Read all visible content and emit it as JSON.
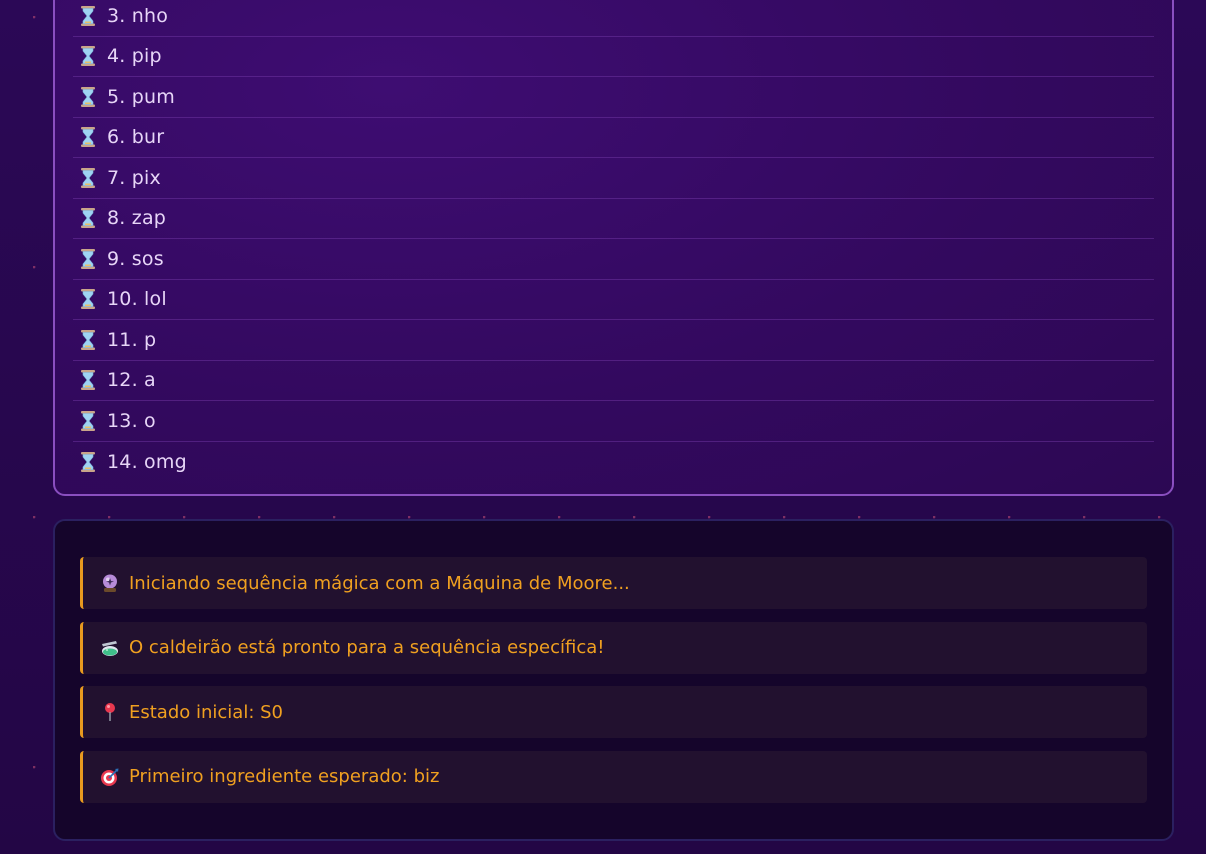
{
  "sequence": {
    "items": [
      {
        "label": "3. nho",
        "icon": "hourglass-icon"
      },
      {
        "label": "4. pip",
        "icon": "hourglass-icon"
      },
      {
        "label": "5. pum",
        "icon": "hourglass-icon"
      },
      {
        "label": "6. bur",
        "icon": "hourglass-icon"
      },
      {
        "label": "7. pix",
        "icon": "hourglass-icon"
      },
      {
        "label": "8. zap",
        "icon": "hourglass-icon"
      },
      {
        "label": "9. sos",
        "icon": "hourglass-icon"
      },
      {
        "label": "10. lol",
        "icon": "hourglass-icon"
      },
      {
        "label": "11. p",
        "icon": "hourglass-icon"
      },
      {
        "label": "12. a",
        "icon": "hourglass-icon"
      },
      {
        "label": "13. o",
        "icon": "hourglass-icon"
      },
      {
        "label": "14. omg",
        "icon": "hourglass-icon"
      }
    ]
  },
  "log": {
    "entries": [
      {
        "icon": "crystal-ball-icon",
        "glyph": "🔮",
        "text": "Iniciando sequência mágica com a Máquina de Moore..."
      },
      {
        "icon": "potion-icon",
        "glyph": "⚗",
        "text": "O caldeirão está pronto para a sequência específica!"
      },
      {
        "icon": "pin-icon",
        "glyph": "📍",
        "text": "Estado inicial: S0"
      },
      {
        "icon": "target-icon",
        "glyph": "🎯",
        "text": "Primeiro ingrediente esperado: biz"
      }
    ]
  },
  "colors": {
    "background": "#2a0a52",
    "panel_border": "#8a4fc0",
    "list_text": "#e7d6f7",
    "log_text": "#f0a020",
    "log_accent": "#e89a1f"
  }
}
